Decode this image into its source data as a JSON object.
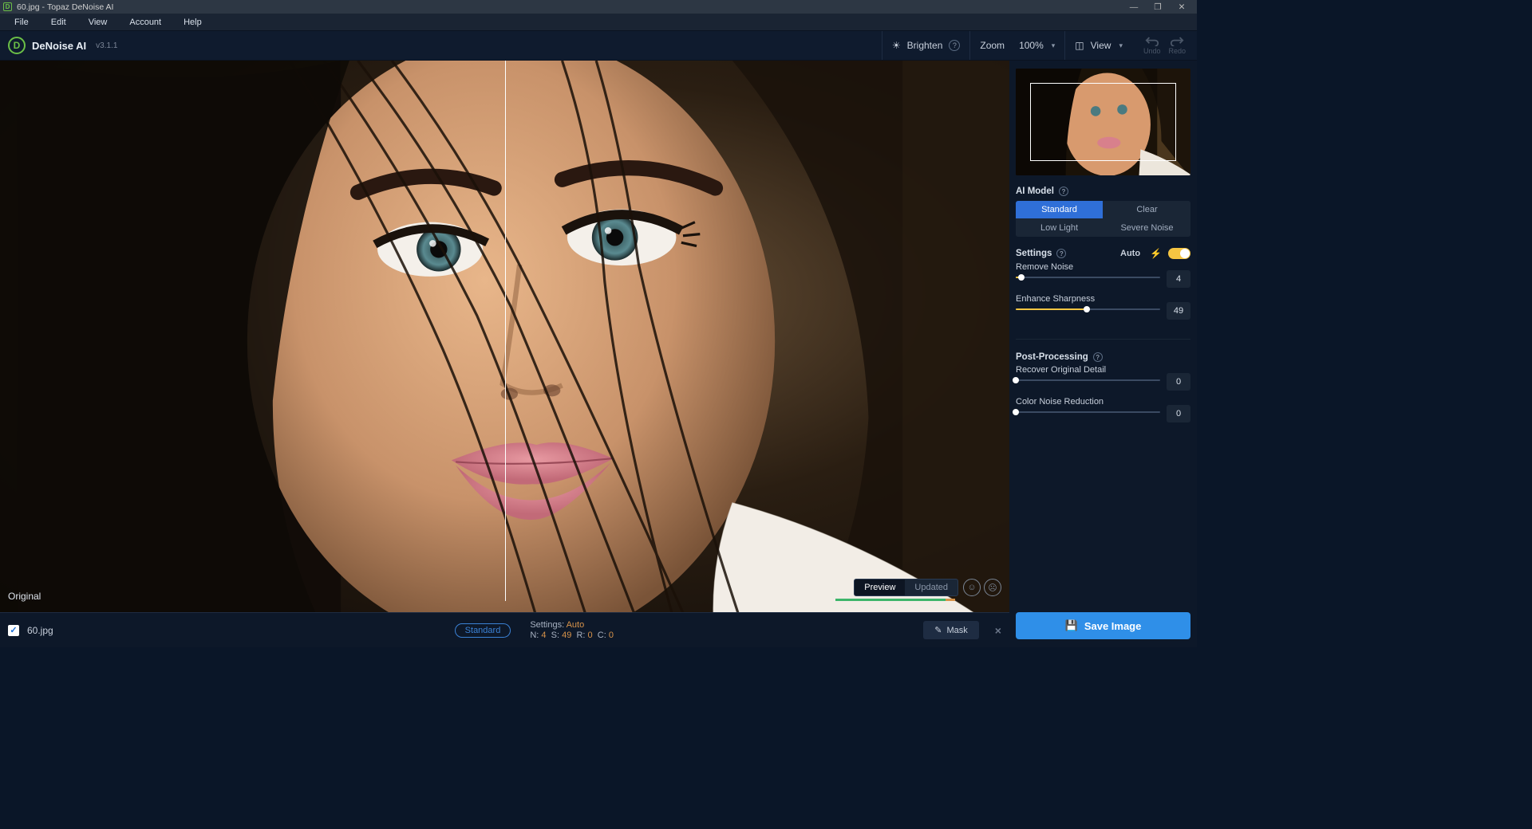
{
  "titlebar": {
    "file": "60.jpg",
    "app": "Topaz DeNoise AI"
  },
  "menubar": [
    "File",
    "Edit",
    "View",
    "Account",
    "Help"
  ],
  "toolbar": {
    "app_name": "DeNoise AI",
    "version": "v3.1.1",
    "brighten": "Brighten",
    "zoom": "Zoom",
    "zoom_value": "100%",
    "view": "View",
    "undo": "Undo",
    "redo": "Redo"
  },
  "canvas": {
    "original_label": "Original",
    "preview": "Preview",
    "updated": "Updated"
  },
  "filmstrip": {
    "filename": "60.jpg",
    "badge": "Standard",
    "settings_label": "Settings:",
    "settings_value": "Auto",
    "n_label": "N:",
    "n_val": "4",
    "s_label": "S:",
    "s_val": "49",
    "r_label": "R:",
    "r_val": "0",
    "c_label": "C:",
    "c_val": "0",
    "mask": "Mask"
  },
  "sidebar": {
    "ai_model": {
      "title": "AI Model",
      "options": [
        "Standard",
        "Clear",
        "Low Light",
        "Severe Noise"
      ],
      "active": 0
    },
    "settings": {
      "title": "Settings",
      "auto": "Auto",
      "sliders": [
        {
          "label": "Remove Noise",
          "value": 4,
          "max": 100
        },
        {
          "label": "Enhance Sharpness",
          "value": 49,
          "max": 100
        }
      ]
    },
    "post": {
      "title": "Post-Processing",
      "sliders": [
        {
          "label": "Recover Original Detail",
          "value": 0,
          "max": 100
        },
        {
          "label": "Color Noise Reduction",
          "value": 0,
          "max": 100
        }
      ]
    },
    "save": "Save Image"
  }
}
